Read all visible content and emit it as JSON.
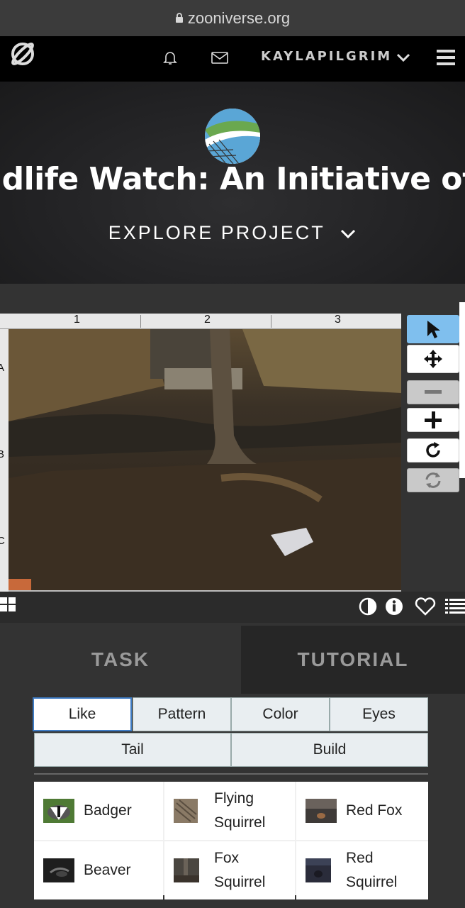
{
  "browser": {
    "url": "zooniverse.org"
  },
  "nav": {
    "username": "KAYLAPILGRIM"
  },
  "hero": {
    "title": "ldlife Watch: An Initiative of t",
    "explore_label": "EXPLORE PROJECT"
  },
  "viewer": {
    "ruler_top": [
      "1",
      "2",
      "3"
    ],
    "ruler_left": [
      "A",
      "B",
      "C"
    ]
  },
  "task_tabs": {
    "task": "TASK",
    "tutorial": "TUTORIAL"
  },
  "filters": [
    "Like",
    "Pattern",
    "Color",
    "Eyes",
    "Tail",
    "Build"
  ],
  "choices": [
    {
      "label": "Badger",
      "thumb": "badger"
    },
    {
      "label": "Flying Squirrel",
      "thumb": "flying-squirrel"
    },
    {
      "label": "Red Fox",
      "thumb": "red-fox"
    },
    {
      "label": "Beaver",
      "thumb": "beaver"
    },
    {
      "label": "Fox Squirrel",
      "thumb": "fox-squirrel"
    },
    {
      "label": "Red Squirrel",
      "thumb": "red-squirrel"
    }
  ],
  "colors": {
    "active_tool": "#7fbfee",
    "selected_filter_border": "#3e7bc4",
    "nav_bg": "#000000"
  }
}
